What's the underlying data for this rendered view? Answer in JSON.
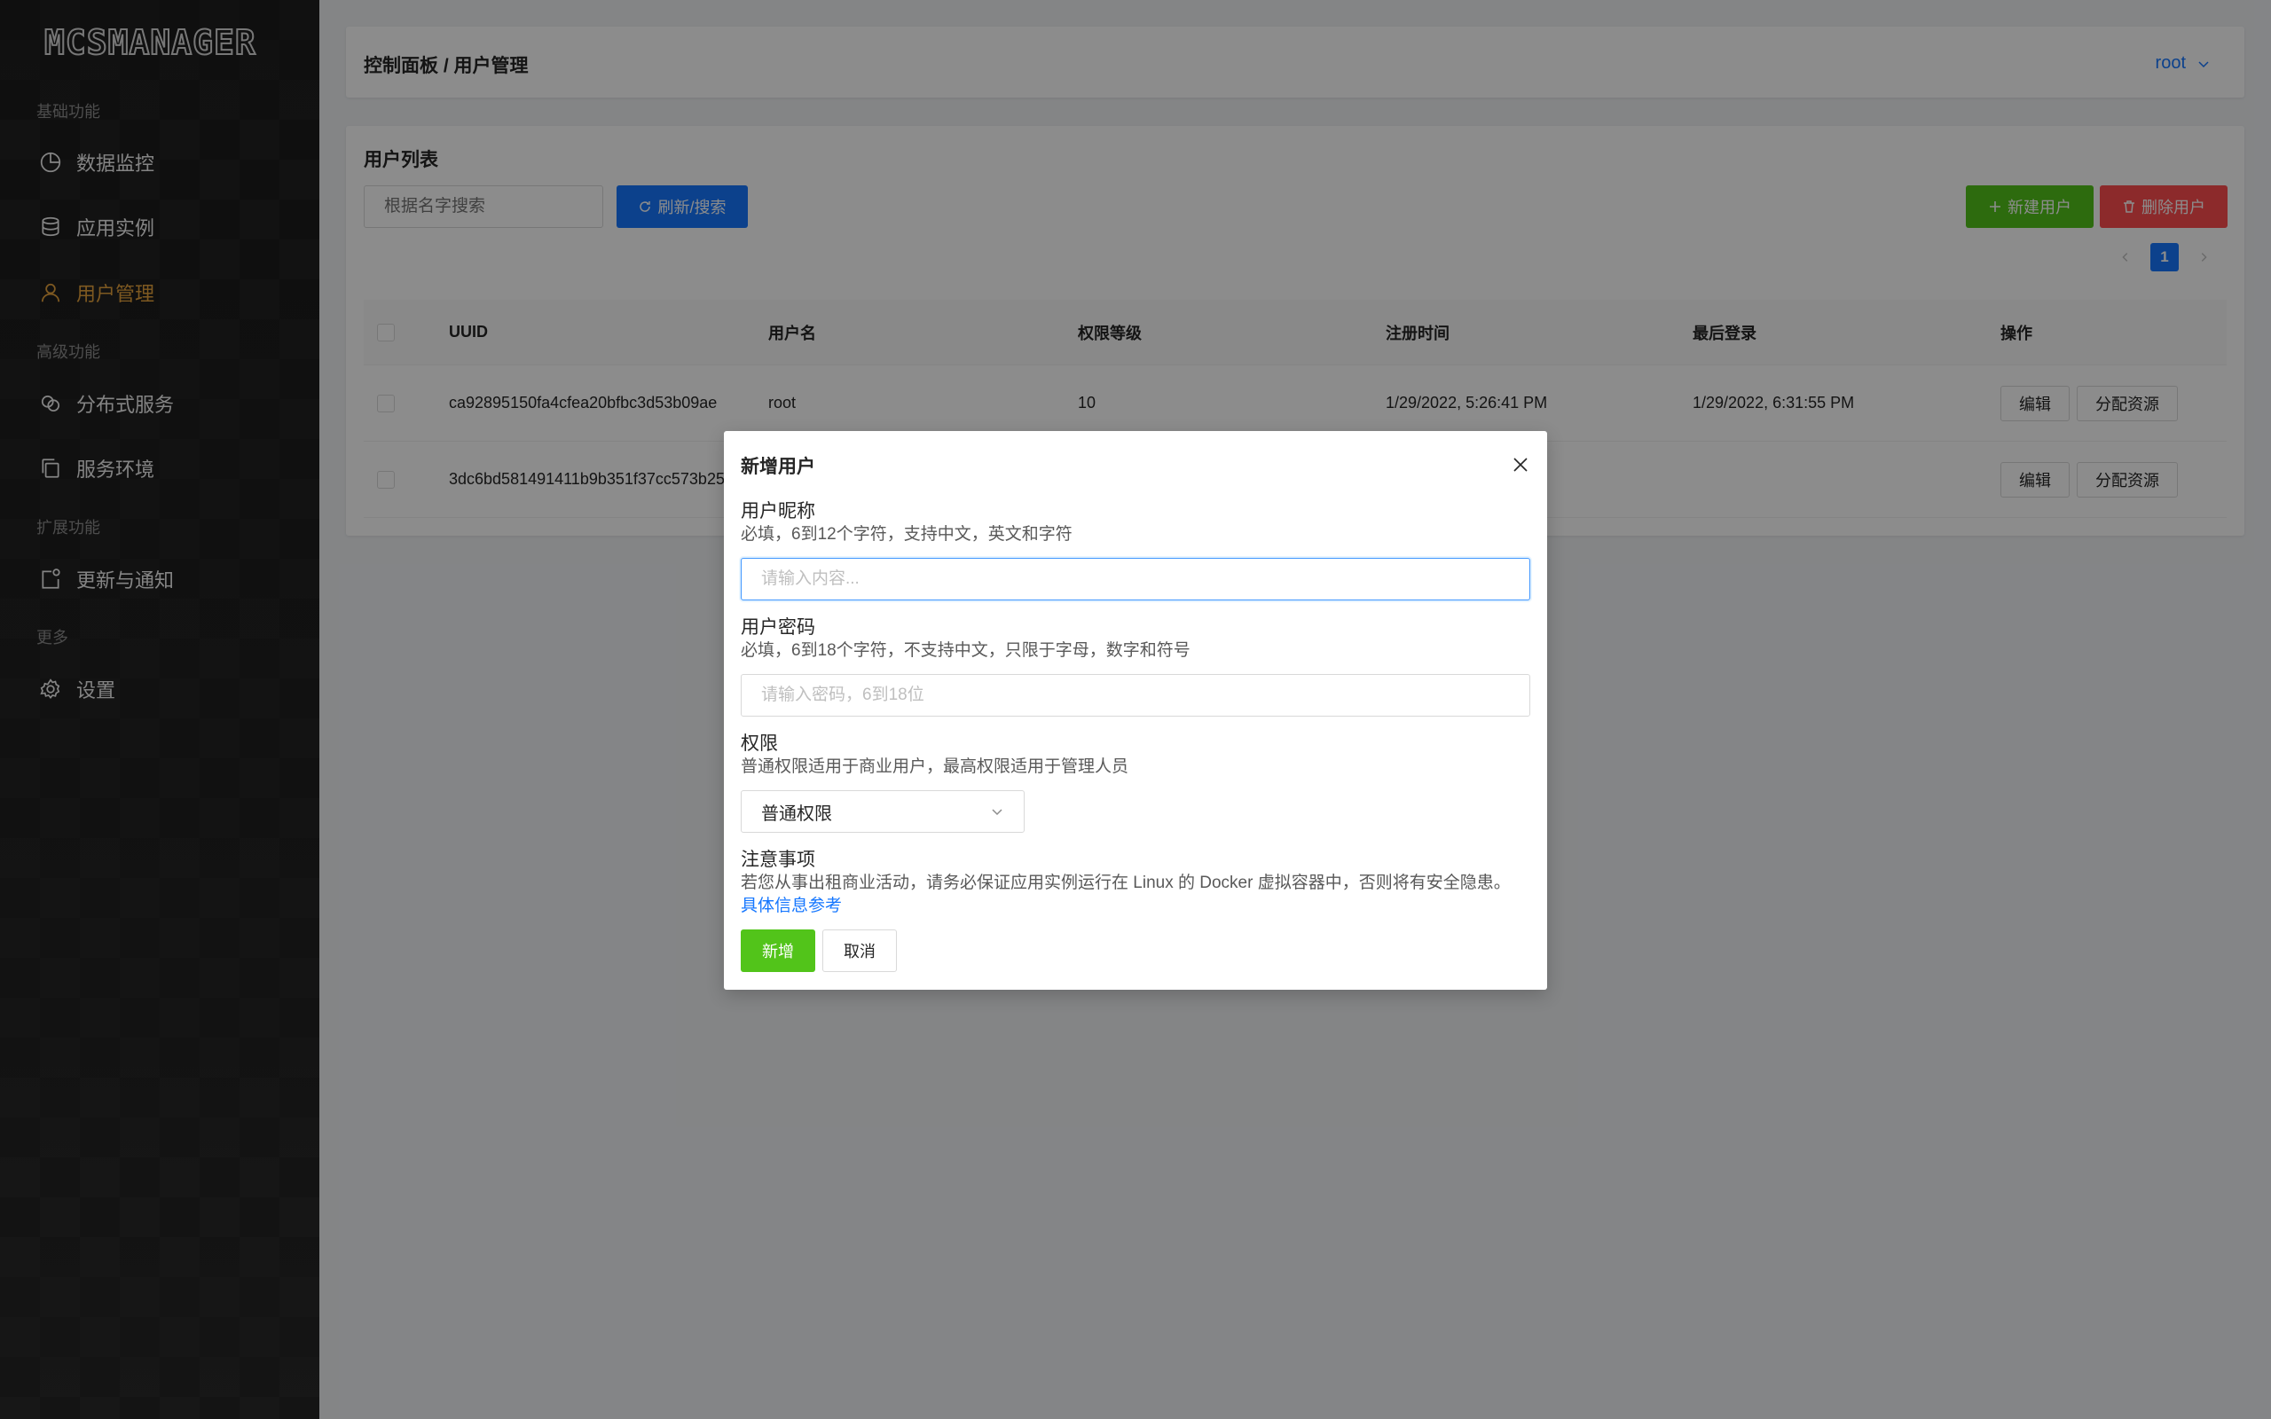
{
  "sidebar": {
    "logo": "MCSMANAGER",
    "groups": [
      {
        "label": "基础功能"
      },
      {
        "label": "高级功能"
      },
      {
        "label": "扩展功能"
      },
      {
        "label": "更多"
      }
    ],
    "items": [
      {
        "label": "数据监控",
        "icon": "pie-chart-icon"
      },
      {
        "label": "应用实例",
        "icon": "database-icon"
      },
      {
        "label": "用户管理",
        "icon": "user-icon",
        "active": true
      },
      {
        "label": "分布式服务",
        "icon": "cluster-icon"
      },
      {
        "label": "服务环境",
        "icon": "copy-icon"
      },
      {
        "label": "更新与通知",
        "icon": "notification-icon"
      },
      {
        "label": "设置",
        "icon": "gear-icon"
      }
    ]
  },
  "header": {
    "breadcrumb": "控制面板 / 用户管理",
    "user": "root"
  },
  "card": {
    "title": "用户列表",
    "search_placeholder": "根据名字搜索",
    "refresh_label": "刷新/搜索",
    "new_user_label": "新建用户",
    "delete_user_label": "删除用户",
    "page": "1"
  },
  "table": {
    "columns": [
      "UUID",
      "用户名",
      "权限等级",
      "注册时间",
      "最后登录",
      "操作"
    ],
    "rows": [
      {
        "uuid": "ca92895150fa4cfea20bfbc3d53b09ae",
        "username": "root",
        "level": "10",
        "registered": "1/29/2022, 5:26:41 PM",
        "last_login": "1/29/2022, 6:31:55 PM"
      },
      {
        "uuid": "3dc6bd581491411b9b351f37cc573b25",
        "username": "",
        "level": "",
        "registered": "",
        "last_login": ""
      }
    ],
    "actions": {
      "edit": "编辑",
      "assign": "分配资源"
    }
  },
  "modal": {
    "title": "新增用户",
    "nickname_label": "用户昵称",
    "nickname_desc": "必填，6到12个字符，支持中文，英文和字符",
    "nickname_placeholder": "请输入内容...",
    "password_label": "用户密码",
    "password_desc": "必填，6到18个字符，不支持中文，只限于字母，数字和符号",
    "password_placeholder": "请输入密码，6到18位",
    "permission_label": "权限",
    "permission_desc": "普通权限适用于商业用户，最高权限适用于管理人员",
    "permission_value": "普通权限",
    "notice_label": "注意事项",
    "notice_text": "若您从事出租商业活动，请务必保证应用实例运行在 Linux 的 Docker 虚拟容器中，否则将有安全隐患。",
    "notice_link": "具体信息参考",
    "submit_label": "新增",
    "cancel_label": "取消"
  },
  "colors": {
    "primary": "#1677ff",
    "success": "#52c41a",
    "danger": "#ff4d4f",
    "active_nav": "#e6a23c"
  }
}
